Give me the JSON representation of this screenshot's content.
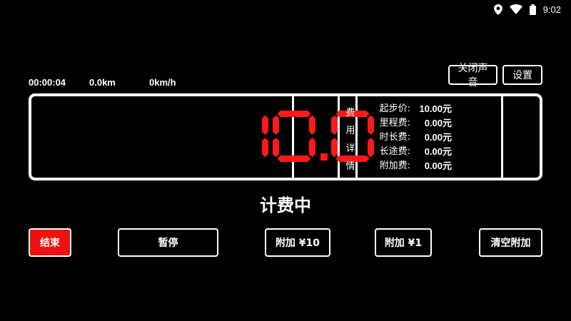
{
  "status_bar": {
    "time": "9:02",
    "icons": [
      "location-icon",
      "wifi-icon",
      "battery-icon"
    ]
  },
  "trip": {
    "duration": "00:00:04",
    "distance": "0.0km",
    "speed": "0km/h"
  },
  "top_buttons": {
    "mute_label": "关闭声音",
    "settings_label": "设置"
  },
  "meter": {
    "fare_display": "10.0",
    "digit_color": "#ff1a1a",
    "fee_tab_chars": [
      "费",
      "用",
      "详",
      "情"
    ],
    "fees": [
      {
        "label": "起步价:",
        "value": "10.00元"
      },
      {
        "label": "里程费:",
        "value": "0.00元"
      },
      {
        "label": "时长费:",
        "value": "0.00元"
      },
      {
        "label": "长途费:",
        "value": "0.00元"
      },
      {
        "label": "附加费:",
        "value": "0.00元"
      }
    ]
  },
  "status_text": "计费中",
  "bottom_buttons": {
    "end_label": "结束",
    "pause_label": "暂停",
    "add10_label": "附加 ¥10",
    "add1_label": "附加 ¥1",
    "clear_label": "清空附加"
  },
  "colors": {
    "background": "#000000",
    "accent_danger": "#ee1111",
    "foreground": "#ffffff"
  }
}
